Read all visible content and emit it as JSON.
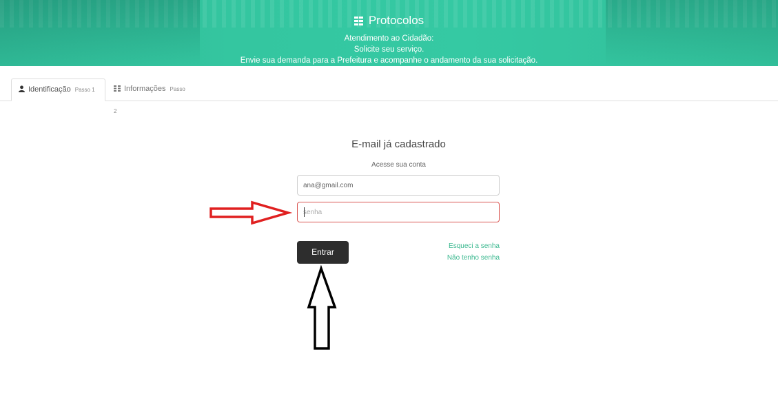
{
  "header": {
    "title": "Protocolos",
    "title_icon": "grid-icon",
    "line1": "Atendimento ao Cidadão:",
    "line2": "Solicite seu serviço.",
    "line3": "Envie sua demanda para a Prefeitura e acompanhe o andamento da sua solicitação.",
    "color": "#35c9a3"
  },
  "tabs": [
    {
      "icon": "user-icon",
      "label": "Identificação",
      "step": "Passo 1",
      "active": true
    },
    {
      "icon": "grid-icon",
      "label": "Informações",
      "step": "Passo 2",
      "active": false
    }
  ],
  "login": {
    "title": "E-mail já cadastrado",
    "subtitle": "Acesse sua conta",
    "email_value": "ana@gmail.com",
    "password_placeholder": "senha",
    "submit_label": "Entrar",
    "forgot_link": "Esqueci a senha",
    "no_password_link": "Não tenho senha",
    "link_color": "#3bb88f",
    "error_border_color": "#d9534f"
  },
  "annotations": {
    "red_arrow_color": "#e02020",
    "black_arrow_color": "#000000"
  }
}
